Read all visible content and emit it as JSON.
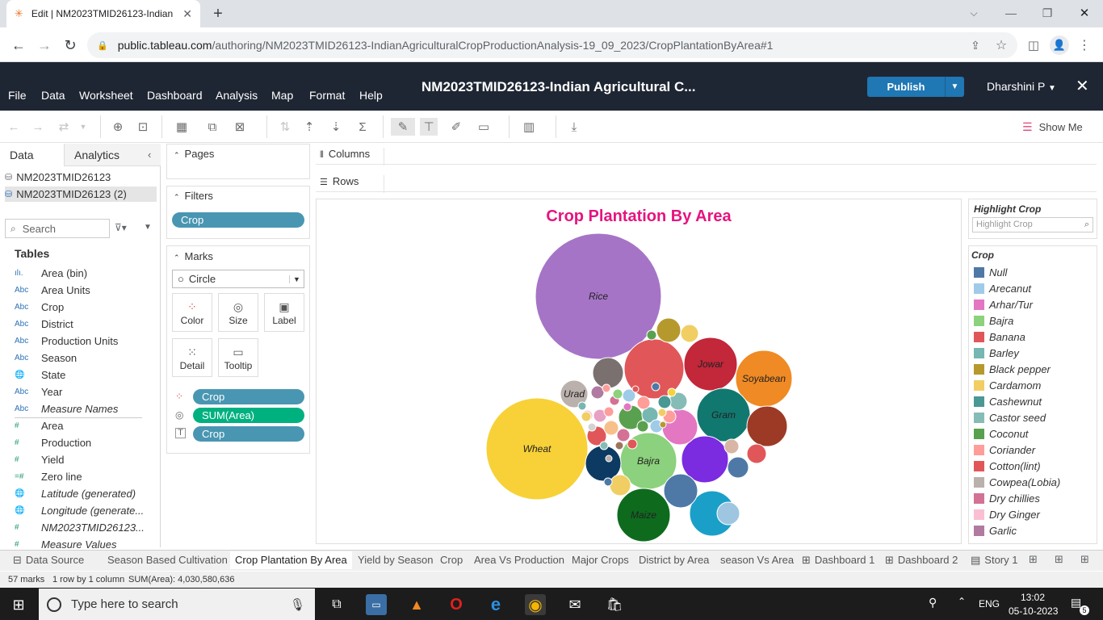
{
  "browser": {
    "tab_title": "Edit | NM2023TMID26123-Indian",
    "url_domain": "public.tableau.com",
    "url_path": "/authoring/NM2023TMID26123-IndianAgriculturalCropProductionAnalysis-19_09_2023/CropPlantationByArea#1"
  },
  "app": {
    "menu": [
      "File",
      "Data",
      "Worksheet",
      "Dashboard",
      "Analysis",
      "Map",
      "Format",
      "Help"
    ],
    "workbook_title": "NM2023TMID26123-Indian Agricultural C...",
    "publish_label": "Publish",
    "user_name": "Dharshini P",
    "show_me_label": "Show Me"
  },
  "data_pane": {
    "tab_data": "Data",
    "tab_analytics": "Analytics",
    "sources": [
      "NM2023TMID26123",
      "NM2023TMID26123 (2)"
    ],
    "search_placeholder": "Search",
    "tables_heading": "Tables",
    "fields": [
      {
        "type": "ılı.",
        "name": "Area (bin)",
        "kind": "dim",
        "italic": false
      },
      {
        "type": "Abc",
        "name": "Area Units",
        "kind": "dim",
        "italic": false
      },
      {
        "type": "Abc",
        "name": "Crop",
        "kind": "dim",
        "italic": false
      },
      {
        "type": "Abc",
        "name": "District",
        "kind": "dim",
        "italic": false
      },
      {
        "type": "Abc",
        "name": "Production Units",
        "kind": "dim",
        "italic": false
      },
      {
        "type": "Abc",
        "name": "Season",
        "kind": "dim",
        "italic": false
      },
      {
        "type": "🌐",
        "name": "State",
        "kind": "dim",
        "italic": false
      },
      {
        "type": "Abc",
        "name": "Year",
        "kind": "dim",
        "italic": false
      },
      {
        "type": "Abc",
        "name": "Measure Names",
        "kind": "dim",
        "italic": true
      },
      {
        "type": "#",
        "name": "Area",
        "kind": "mea",
        "italic": false
      },
      {
        "type": "#",
        "name": "Production",
        "kind": "mea",
        "italic": false
      },
      {
        "type": "#",
        "name": "Yield",
        "kind": "mea",
        "italic": false
      },
      {
        "type": "=#",
        "name": "Zero line",
        "kind": "mea",
        "italic": false
      },
      {
        "type": "🌐",
        "name": "Latitude (generated)",
        "kind": "mea",
        "italic": true
      },
      {
        "type": "🌐",
        "name": "Longitude (generate...",
        "kind": "mea",
        "italic": true
      },
      {
        "type": "#",
        "name": "NM2023TMID26123...",
        "kind": "mea",
        "italic": true
      },
      {
        "type": "#",
        "name": "Measure Values",
        "kind": "mea",
        "italic": true
      }
    ]
  },
  "shelves": {
    "pages_label": "Pages",
    "filters_label": "Filters",
    "filter_pill": "Crop",
    "marks_label": "Marks",
    "mark_type": "Circle",
    "mark_buttons": [
      "Color",
      "Size",
      "Label",
      "Detail",
      "Tooltip"
    ],
    "mark_pills": [
      "Crop",
      "SUM(Area)",
      "Crop"
    ],
    "columns_label": "Columns",
    "rows_label": "Rows"
  },
  "chart_data": {
    "type": "bubble",
    "title": "Crop Plantation By Area",
    "measure": "SUM(Area)",
    "total": "4,030,580,636",
    "marks_count": 57,
    "labeled_bubbles": [
      "Rice",
      "Wheat",
      "Jowar",
      "Soyabean",
      "Gram",
      "Bajra",
      "Maize",
      "Urad"
    ]
  },
  "legend": {
    "highlight_title": "Highlight Crop",
    "highlight_placeholder": "Highlight Crop",
    "title": "Crop",
    "items": [
      {
        "name": "Null",
        "color": "#4e79a7"
      },
      {
        "name": "Arecanut",
        "color": "#a0cbe8"
      },
      {
        "name": "Arhar/Tur",
        "color": "#e377c2"
      },
      {
        "name": "Bajra",
        "color": "#8cd17d"
      },
      {
        "name": "Banana",
        "color": "#e15759"
      },
      {
        "name": "Barley",
        "color": "#76b7b2"
      },
      {
        "name": "Black pepper",
        "color": "#b6992d"
      },
      {
        "name": "Cardamom",
        "color": "#f1ce63"
      },
      {
        "name": "Cashewnut",
        "color": "#499894"
      },
      {
        "name": "Castor seed",
        "color": "#86bcb6"
      },
      {
        "name": "Coconut",
        "color": "#59a14f"
      },
      {
        "name": "Coriander",
        "color": "#ff9d9a"
      },
      {
        "name": "Cotton(lint)",
        "color": "#e15759"
      },
      {
        "name": "Cowpea(Lobia)",
        "color": "#bab0ac"
      },
      {
        "name": "Dry chillies",
        "color": "#d37295"
      },
      {
        "name": "Dry Ginger",
        "color": "#fabfd2"
      },
      {
        "name": "Garlic",
        "color": "#b07aa1"
      }
    ]
  },
  "sheet_tabs": [
    {
      "label": "Data Source",
      "icon": "⊟"
    },
    {
      "label": "Season Based Cultivation",
      "icon": ""
    },
    {
      "label": "Crop Plantation By Area",
      "icon": ""
    },
    {
      "label": "Yield by Season",
      "icon": ""
    },
    {
      "label": "Crop",
      "icon": ""
    },
    {
      "label": "Area Vs Production",
      "icon": ""
    },
    {
      "label": "Major Crops",
      "icon": ""
    },
    {
      "label": "District by Area",
      "icon": ""
    },
    {
      "label": "season Vs Area",
      "icon": ""
    },
    {
      "label": "Dashboard 1",
      "icon": "⊞"
    },
    {
      "label": "Dashboard 2",
      "icon": "⊞"
    },
    {
      "label": "Story 1",
      "icon": "▤"
    }
  ],
  "status": {
    "marks": "57 marks",
    "rowcol": "1 row by 1 column",
    "sum": "SUM(Area): 4,030,580,636"
  },
  "taskbar": {
    "search_placeholder": "Type here to search",
    "language": "ENG",
    "time": "13:02",
    "date": "05-10-2023",
    "notif_count": "5"
  }
}
